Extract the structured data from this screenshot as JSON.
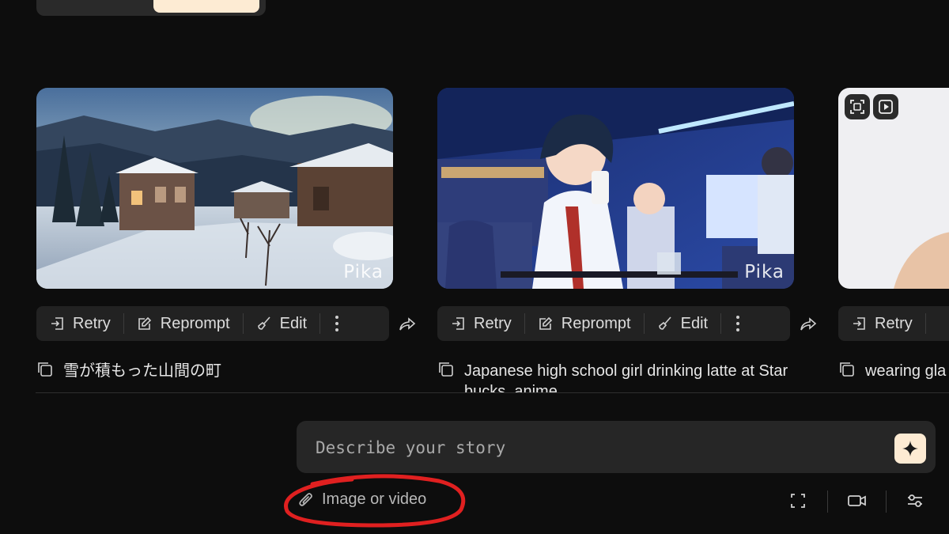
{
  "cards": [
    {
      "scene": "snowy-mountain-town",
      "watermark": "Pika",
      "actions": {
        "retry": "Retry",
        "reprompt": "Reprompt",
        "edit": "Edit"
      },
      "prompt": "雪が積もった山間の町"
    },
    {
      "scene": "anime-girl-cafe",
      "watermark": "Pika",
      "actions": {
        "retry": "Retry",
        "reprompt": "Reprompt",
        "edit": "Edit"
      },
      "prompt": "Japanese high school girl drinking latte at Starbucks, anime"
    },
    {
      "scene": "partial-portrait",
      "actions": {
        "retry": "Retry"
      },
      "prompt": "wearing gla"
    }
  ],
  "composer": {
    "placeholder": "Describe your story",
    "attach_label": "Image or video"
  },
  "colors": {
    "accent": "#fdebd3",
    "annotation": "#e02020",
    "background": "#0d0d0d"
  }
}
